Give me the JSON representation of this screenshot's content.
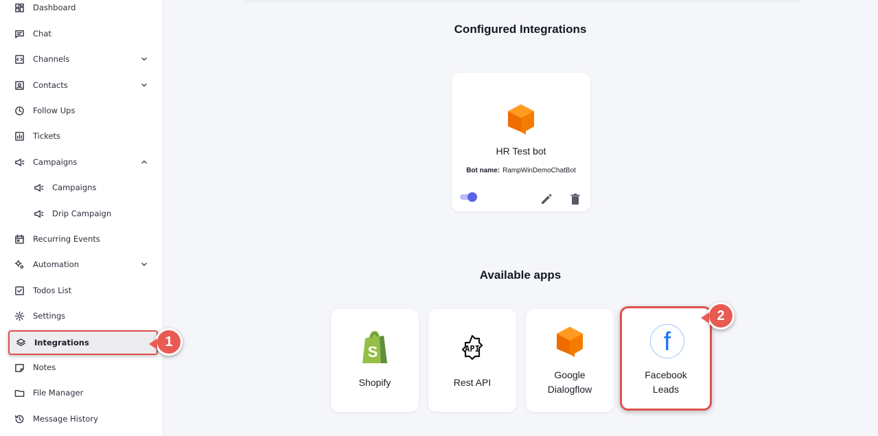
{
  "sidebar": {
    "items": [
      {
        "label": "Dashboard",
        "icon": "dashboard-icon"
      },
      {
        "label": "Chat",
        "icon": "chat-icon"
      },
      {
        "label": "Channels",
        "icon": "channels-icon",
        "chevron": "down"
      },
      {
        "label": "Contacts",
        "icon": "contacts-icon",
        "chevron": "down"
      },
      {
        "label": "Follow Ups",
        "icon": "clock-icon"
      },
      {
        "label": "Tickets",
        "icon": "tickets-icon"
      },
      {
        "label": "Campaigns",
        "icon": "megaphone-icon",
        "chevron": "up"
      },
      {
        "label": "Campaigns",
        "icon": "megaphone-icon",
        "sub": true
      },
      {
        "label": "Drip Campaign",
        "icon": "megaphone-icon",
        "sub": true
      },
      {
        "label": "Recurring Events",
        "icon": "calendar-icon"
      },
      {
        "label": "Automation",
        "icon": "gears-icon",
        "chevron": "down"
      },
      {
        "label": "Todos List",
        "icon": "checkbox-icon"
      },
      {
        "label": "Settings",
        "icon": "gear-icon"
      },
      {
        "label": "Integrations",
        "icon": "layers-icon",
        "active": true
      },
      {
        "label": "Notes",
        "icon": "note-icon"
      },
      {
        "label": "File Manager",
        "icon": "folder-icon"
      },
      {
        "label": "Message History",
        "icon": "history-icon"
      }
    ]
  },
  "callouts": {
    "first": "1",
    "second": "2"
  },
  "configured": {
    "title": "Configured Integrations",
    "card": {
      "name": "HR Test bot",
      "bot_name_label": "Bot name:",
      "bot_name_value": "RampWinDemoChatBot",
      "enabled": true,
      "logo_icon": "dialogflow-icon"
    }
  },
  "available": {
    "title": "Available apps",
    "apps": [
      {
        "label": "Shopify",
        "icon": "shopify-icon"
      },
      {
        "label": "Rest API",
        "icon": "api-icon"
      },
      {
        "label_line1": "Google",
        "label_line2": "Dialogflow",
        "icon": "dialogflow-icon"
      },
      {
        "label_line1": "Facebook",
        "label_line2": "Leads",
        "icon": "facebook-icon"
      }
    ]
  },
  "colors": {
    "accent": "#5a63e8",
    "highlight": "#e0514a",
    "dialogflow": "#f57c00",
    "shopify": "#95bf47",
    "facebook": "#1877f2"
  }
}
